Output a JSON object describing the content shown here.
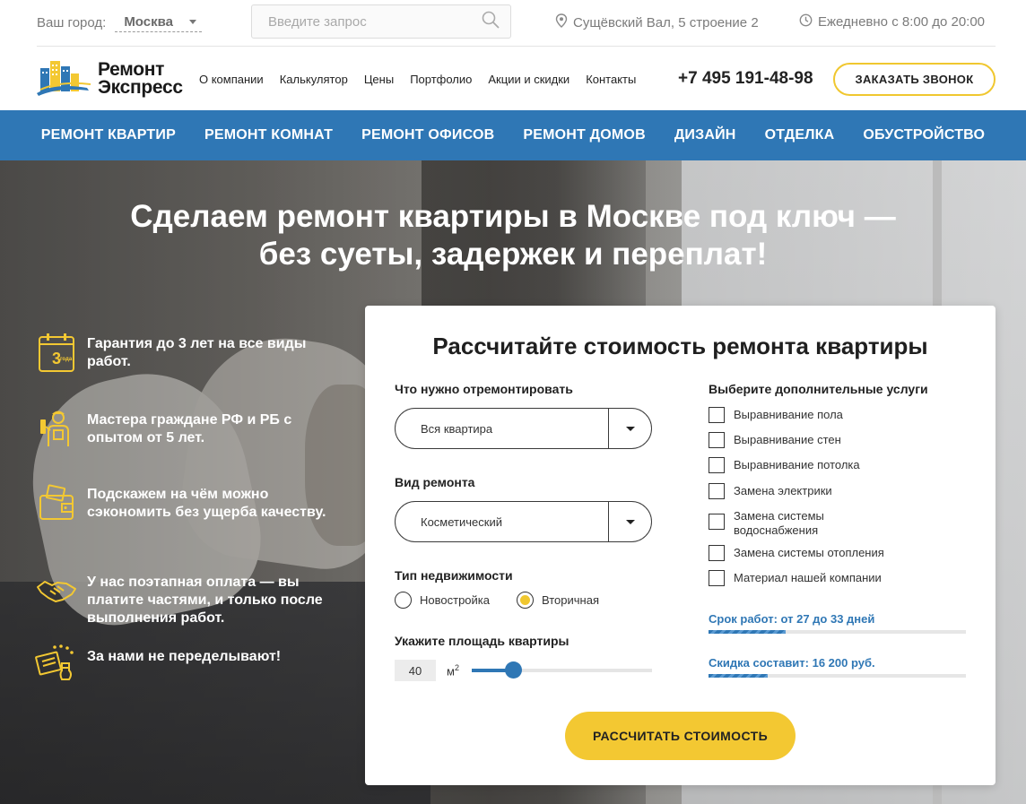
{
  "topbar": {
    "city_label": "Ваш город:",
    "city_value": "Москва",
    "search_placeholder": "Введите запрос",
    "address": "Сущёвский Вал, 5 строение 2",
    "hours": "Ежедневно с 8:00 до 20:00"
  },
  "header": {
    "logo_line1": "Ремонт",
    "logo_line2": "Экспресс",
    "nav": [
      "О компании",
      "Калькулятор",
      "Цены",
      "Портфолио",
      "Акции и скидки",
      "Контакты"
    ],
    "phone": "+7 495 191-48-98",
    "callback_label": "ЗАКАЗАТЬ ЗВОНОК"
  },
  "mainnav": [
    "РЕМОНТ КВАРТИР",
    "РЕМОНТ КОМНАТ",
    "РЕМОНТ ОФИСОВ",
    "РЕМОНТ ДОМОВ",
    "ДИЗАЙН",
    "ОТДЕЛКА",
    "ОБУСТРОЙСТВО"
  ],
  "hero": {
    "title_line1": "Сделаем ремонт квартиры в Москве под ключ —",
    "title_line2": "без суеты, задержек и переплат!",
    "features": [
      "Гарантия до 3 лет на все виды работ.",
      "Мастера граждане РФ и РБ с опытом от 5 лет.",
      "Подскажем на чём можно сэкономить без ущерба качеству.",
      "У нас поэтапная оплата — вы платите частями, и только после выполнения работ.",
      "За нами не переделывают!"
    ],
    "guarantee_icon_text": "3",
    "guarantee_icon_sub": "года"
  },
  "calculator": {
    "title": "Рассчитайте стоимость ремонта квартиры",
    "what_label": "Что нужно отремонтировать",
    "what_value": "Вся квартира",
    "kind_label": "Вид ремонта",
    "kind_value": "Косметический",
    "property_label": "Тип недвижимости",
    "property_options": [
      "Новостройка",
      "Вторичная"
    ],
    "property_selected": "Вторичная",
    "area_label": "Укажите площадь квартиры",
    "area_value": "40",
    "area_unit": "м",
    "area_unit_sup": "2",
    "area_slider_fraction": 0.23,
    "extras_label": "Выберите дополнительные услуги",
    "extras": [
      "Выравнивание пола",
      "Выравнивание стен",
      "Выравнивание потолка",
      "Замена электрики",
      "Замена системы водоснабжения",
      "Замена системы отопления",
      "Материал нашей компании"
    ],
    "term_text": "Срок работ: от 27 до 33 дней",
    "term_fraction": 0.3,
    "discount_text": "Скидка составит: 16 200 руб.",
    "discount_fraction": 0.23,
    "submit_label": "РАССЧИТАТЬ СТОИМОСТЬ"
  },
  "colors": {
    "accent_yellow": "#f3c832",
    "nav_blue": "#2f77b5"
  }
}
